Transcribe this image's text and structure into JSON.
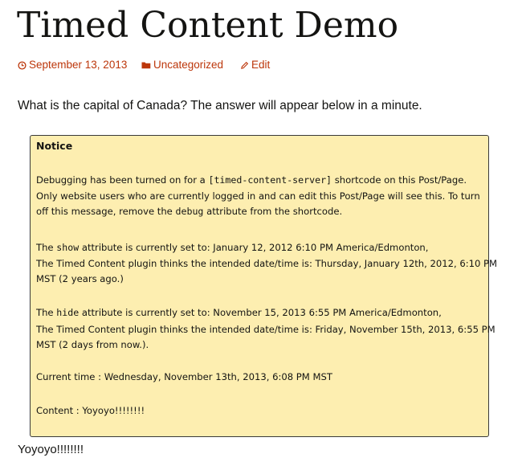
{
  "post": {
    "title": "Timed Content Demo",
    "meta": {
      "date": "September 13, 2013",
      "category": "Uncategorized",
      "edit": "Edit",
      "icons": [
        "clock-icon",
        "folder-icon",
        "pencil-icon"
      ],
      "link_color": "#bc360a"
    },
    "question": "What is the capital of Canada? The answer will appear below in a minute."
  },
  "notice": {
    "heading": "Notice",
    "debug_line1_a": "Debugging has been turned on for a ",
    "debug_line1_code": "[timed-content-server]",
    "debug_line1_b": " shortcode on this Post/Page.",
    "debug_line2": "Only website users who are currently logged in and can edit this Post/Page will see this. To turn",
    "debug_line3_a": "off this message, remove the ",
    "debug_line3_code": "debug",
    "debug_line3_b": " attribute from the shortcode.",
    "show_a": "The ",
    "show_code": "show",
    "show_b": " attribute is currently set to: January 12, 2012 6:10 PM America/Edmonton,",
    "show_interp1": "The Timed Content plugin thinks the intended date/time is: Thursday, January 12th, 2012, 6:10 PM",
    "show_interp2": "MST (2 years ago.)",
    "hide_a": "The ",
    "hide_code": "hide",
    "hide_b": " attribute is currently set to: November 15, 2013 6:55 PM America/Edmonton,",
    "hide_interp1": "The Timed Content plugin thinks the intended date/time is: Friday, November 15th, 2013, 6:55 PM",
    "hide_interp2": "MST (2 days from now.).",
    "current_time": "Current time : Wednesday, November 13th, 2013, 6:08 PM MST",
    "content": "Content : Yoyoyo!!!!!!!!",
    "background": "#fdeeb0"
  },
  "output": "Yoyoyo!!!!!!!!"
}
